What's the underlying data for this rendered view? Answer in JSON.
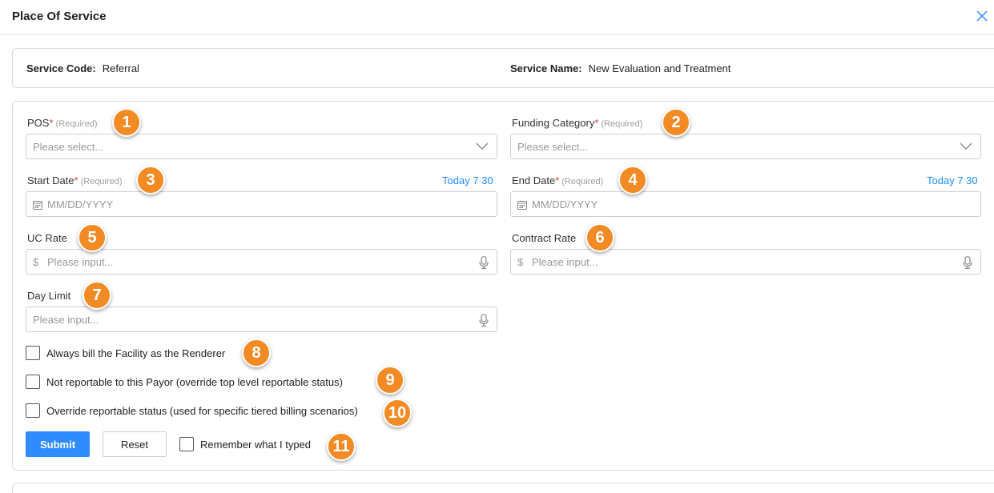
{
  "header": {
    "title": "Place Of Service",
    "close_icon": "close-icon"
  },
  "service": {
    "code_label": "Service Code:",
    "code_value": "Referral",
    "name_label": "Service Name:",
    "name_value": "New Evaluation and Treatment"
  },
  "fields": {
    "pos": {
      "label": "POS",
      "required_mark": "*",
      "required_hint": "(Required)",
      "placeholder": "Please select..."
    },
    "funding_category": {
      "label": "Funding Category",
      "required_mark": "*",
      "required_hint": "(Required)",
      "placeholder": "Please select..."
    },
    "start_date": {
      "label": "Start Date",
      "required_mark": "*",
      "required_hint": "(Required)",
      "placeholder": "MM/DD/YYYY",
      "shortcut": "Today 7 30"
    },
    "end_date": {
      "label": "End Date",
      "required_mark": "*",
      "required_hint": "(Required)",
      "placeholder": "MM/DD/YYYY",
      "shortcut": "Today 7 30"
    },
    "uc_rate": {
      "label": "UC Rate",
      "prefix": "$",
      "placeholder": "Please input..."
    },
    "contract_rate": {
      "label": "Contract Rate",
      "prefix": "$",
      "placeholder": "Please input..."
    },
    "day_limit": {
      "label": "Day Limit",
      "placeholder": "Please input..."
    }
  },
  "checkboxes": {
    "always_bill": "Always bill the Facility as the Renderer",
    "not_reportable": "Not reportable to this Payor (override top level reportable status)",
    "override_reportable": "Override reportable status (used for specific tiered billing scenarios)",
    "remember": "Remember what I typed"
  },
  "buttons": {
    "submit": "Submit",
    "reset": "Reset"
  },
  "badges": [
    "1",
    "2",
    "3",
    "4",
    "5",
    "6",
    "7",
    "8",
    "9",
    "10",
    "11"
  ],
  "colors": {
    "accent": "#2f8cff",
    "link": "#1a8cff",
    "required": "#e53935",
    "badge": "#f28b24"
  }
}
